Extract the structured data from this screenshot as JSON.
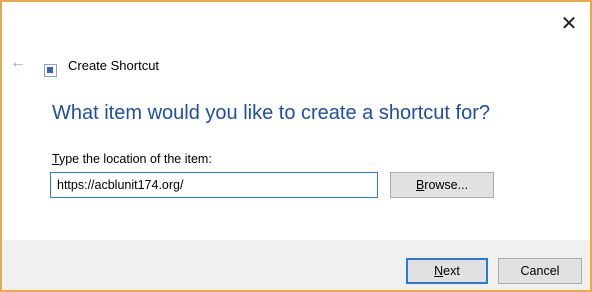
{
  "window": {
    "close_glyph": "✕",
    "back_glyph": "←"
  },
  "header": {
    "title": "Create Shortcut"
  },
  "main": {
    "question": "What item would you like to create a shortcut for?",
    "field_label_first": "T",
    "field_label_rest": "ype the location of the item:",
    "location_value": "https://acblunit174.org/",
    "browse_first": "B",
    "browse_rest": "rowse..."
  },
  "footer": {
    "next_first": "N",
    "next_rest": "ext",
    "cancel_label": "Cancel"
  },
  "colors": {
    "accent": "#1e4fa0",
    "focus": "#2a7ad6",
    "window_border": "#e8a84c"
  }
}
